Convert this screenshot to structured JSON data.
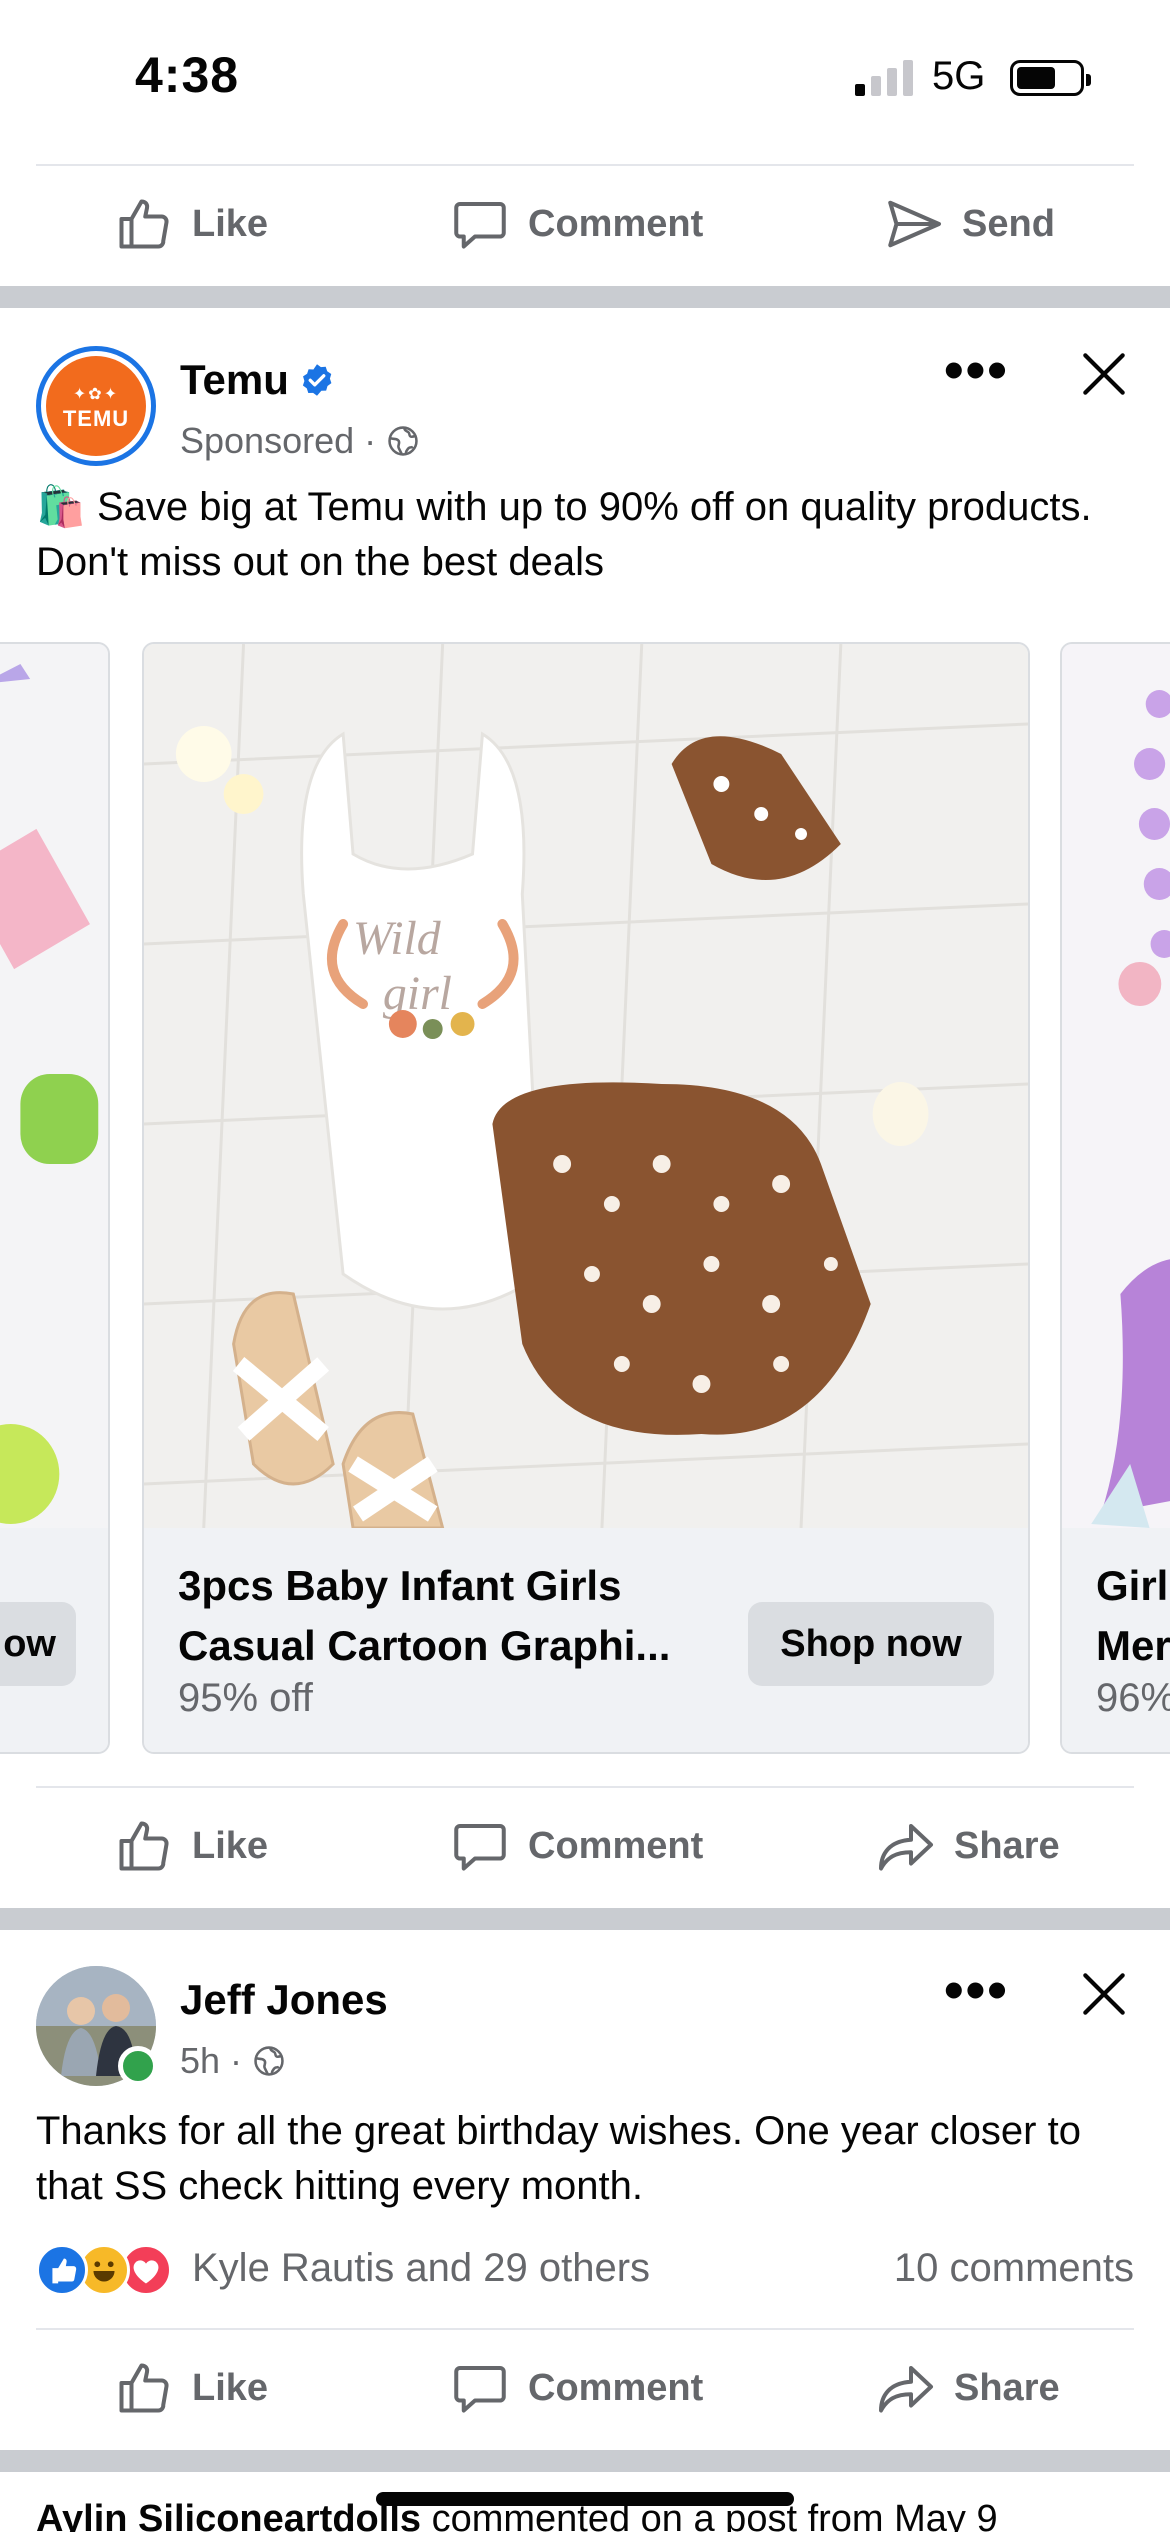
{
  "status_bar": {
    "time": "4:38",
    "network": "5G"
  },
  "top_actions": [
    {
      "label": "Like",
      "icon": "like-icon"
    },
    {
      "label": "Comment",
      "icon": "comment-icon"
    },
    {
      "label": "Send",
      "icon": "send-icon"
    }
  ],
  "ad_post": {
    "author": "Temu",
    "avatar_logo_text": "TEMU",
    "meta": "Sponsored ·",
    "text_emoji": "🛍️",
    "text": "Save big at Temu with up to 90% off on quality products. Don't miss out on the best deals",
    "cards": [
      {
        "title_line1": "",
        "title_line2": "",
        "discount": "",
        "button": "ow"
      },
      {
        "title_line1": "3pcs Baby Infant Girls",
        "title_line2": "Casual Cartoon Graphi...",
        "discount": "95% off",
        "button": "Shop now"
      },
      {
        "title_line1": "Girl",
        "title_line2": "Mer",
        "discount": "96%",
        "button": ""
      }
    ],
    "actions": [
      {
        "label": "Like",
        "icon": "like-icon"
      },
      {
        "label": "Comment",
        "icon": "comment-icon"
      },
      {
        "label": "Share",
        "icon": "share-icon"
      }
    ]
  },
  "jeff_post": {
    "author": "Jeff Jones",
    "meta": "5h ·",
    "text": "Thanks for all the great birthday wishes. One year closer to that SS check hitting every month.",
    "reactions_text": "Kyle Rautis and 29 others",
    "comments_text": "10 comments",
    "actions": [
      {
        "label": "Like",
        "icon": "like-icon"
      },
      {
        "label": "Comment",
        "icon": "comment-icon"
      },
      {
        "label": "Share",
        "icon": "share-icon"
      }
    ]
  },
  "next_post_preview": {
    "name": "Aylin Siliconeartdolls",
    "text": " commented on a post from May 9"
  },
  "colors": {
    "accent": "#1b74e4",
    "temu_orange": "#f26b1d",
    "secondary_text": "#65676b",
    "separator": "#c9ccd1"
  }
}
